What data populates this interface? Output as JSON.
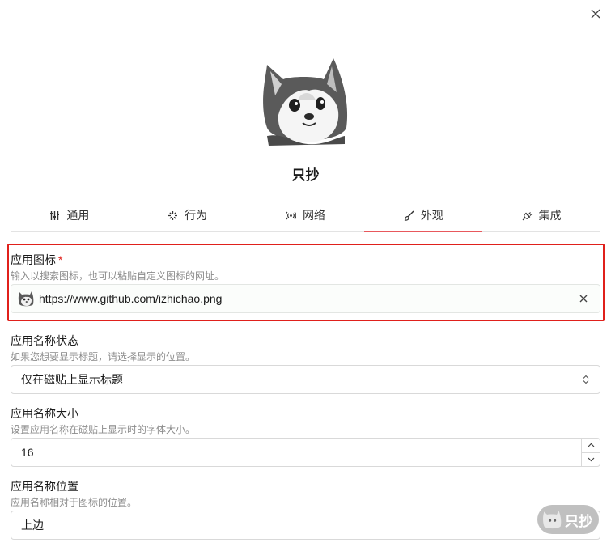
{
  "app": {
    "name": "只抄"
  },
  "tabs": [
    {
      "label": "通用",
      "icon": "sliders-icon"
    },
    {
      "label": "行为",
      "icon": "sparkle-icon"
    },
    {
      "label": "网络",
      "icon": "broadcast-icon"
    },
    {
      "label": "外观",
      "icon": "brush-icon",
      "active": true
    },
    {
      "label": "集成",
      "icon": "plug-icon"
    }
  ],
  "fields": {
    "icon": {
      "label": "应用图标",
      "required": "*",
      "desc": "输入以搜索图标，也可以粘贴自定义图标的网址。",
      "value": "https://www.github.com/izhichao.png"
    },
    "name_state": {
      "label": "应用名称状态",
      "desc": "如果您想要显示标题，请选择显示的位置。",
      "value": "仅在磁贴上显示标题"
    },
    "name_size": {
      "label": "应用名称大小",
      "desc": "设置应用名称在磁贴上显示时的字体大小。",
      "value": "16"
    },
    "name_position": {
      "label": "应用名称位置",
      "desc": "应用名称相对于图标的位置。",
      "value": "上边"
    }
  },
  "watermark": {
    "text": "只抄"
  },
  "colors": {
    "accent": "#e8585c",
    "highlight": "#e0201b"
  }
}
